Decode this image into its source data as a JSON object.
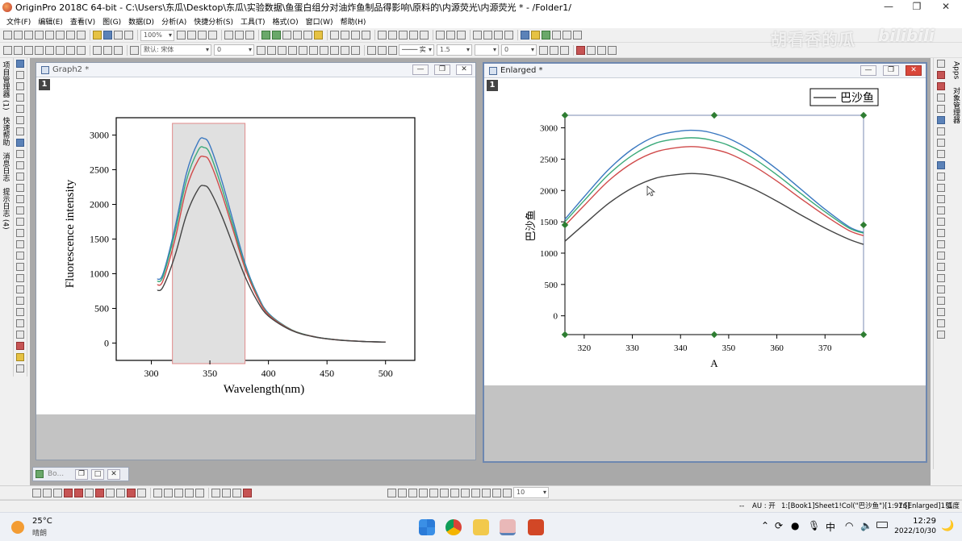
{
  "app": {
    "title": "OriginPro 2018C 64-bit - C:\\Users\\东瓜\\Desktop\\东瓜\\实验数据\\鱼蛋白组分对油炸鱼制品得影响\\原料的\\内源荧光\\内源荧光 * - /Folder1/",
    "window_controls": [
      "—",
      "❐",
      "✕"
    ]
  },
  "menu": [
    "文件(F)",
    "编辑(E)",
    "查看(V)",
    "图(G)",
    "数据(D)",
    "分析(A)",
    "快捷分析(S)",
    "工具(T)",
    "格式(O)",
    "窗口(W)",
    "帮助(H)"
  ],
  "toolbar": {
    "zoom": "100%",
    "font": "默认: 宋体",
    "font_size": "0",
    "line_width": "1.5",
    "line_extra": "0",
    "bottom_size": "10"
  },
  "watermark": "胡看香的瓜",
  "left_panel_labels": [
    "项目管理器 (1)",
    "快速帮助",
    "消息日志",
    "提示日志 (4)"
  ],
  "right_panel_labels": [
    "Apps",
    "对象管理器"
  ],
  "graph2": {
    "title": "Graph2 *",
    "layer": "1",
    "chart": {
      "xlabel": "Wavelength(nm)",
      "ylabel": "Fluorescence intensity",
      "xticks": [
        "300",
        "350",
        "400",
        "450",
        "500"
      ],
      "yticks": [
        "0",
        "500",
        "1000",
        "1500",
        "2000",
        "2500",
        "3000"
      ]
    }
  },
  "enlarged": {
    "title": "Enlarged *",
    "layer": "1",
    "legend": "巴沙鱼",
    "chart": {
      "xlabel": "A",
      "ylabel": "巴沙鱼",
      "xticks": [
        "320",
        "330",
        "340",
        "350",
        "360",
        "370"
      ],
      "yticks": [
        "0",
        "500",
        "1000",
        "1500",
        "2000",
        "2500",
        "3000"
      ]
    }
  },
  "minimized": {
    "label": "Bo..."
  },
  "status": {
    "left": "--",
    "au": "AU : 开",
    "cell": "1:[Book1]Sheet1!Col(\"巴沙鱼\")[1:976]",
    "layer": "1:[Enlarged]1!1",
    "unit": "弧度"
  },
  "taskbar": {
    "temp": "25°C",
    "weather": "晴朗",
    "ime": "中",
    "time": "12:29",
    "date": "2022/10/30"
  },
  "chart_data": [
    {
      "type": "line",
      "title": "",
      "xlabel": "Wavelength(nm)",
      "ylabel": "Fluorescence intensity",
      "xlim": [
        270,
        525
      ],
      "ylim": [
        -250,
        3250
      ],
      "grid": false,
      "highlight_region": [
        318,
        380
      ],
      "x": [
        305,
        310,
        320,
        330,
        340,
        345,
        350,
        360,
        370,
        380,
        390,
        400,
        420,
        440,
        460,
        480,
        500
      ],
      "series": [
        {
          "color": "#3a78c0",
          "values": [
            920,
            1000,
            1650,
            2450,
            2900,
            2950,
            2850,
            2350,
            1750,
            1150,
            720,
            430,
            190,
            90,
            45,
            25,
            15
          ]
        },
        {
          "color": "#3aaa7a",
          "values": [
            890,
            960,
            1580,
            2350,
            2780,
            2820,
            2730,
            2250,
            1680,
            1110,
            700,
            420,
            190,
            90,
            45,
            25,
            15
          ]
        },
        {
          "color": "#d04a4a",
          "values": [
            840,
            900,
            1480,
            2230,
            2640,
            2690,
            2610,
            2160,
            1620,
            1080,
            680,
            410,
            185,
            88,
            44,
            24,
            15
          ]
        },
        {
          "color": "#444444",
          "values": [
            760,
            810,
            1250,
            1850,
            2220,
            2270,
            2200,
            1840,
            1400,
            960,
            620,
            390,
            180,
            86,
            43,
            23,
            14
          ]
        }
      ]
    },
    {
      "type": "line",
      "title": "",
      "xlabel": "A",
      "ylabel": "巴沙鱼",
      "xlim": [
        316,
        378
      ],
      "ylim": [
        -300,
        3200
      ],
      "grid": false,
      "legend": [
        "巴沙鱼"
      ],
      "legend_position": "top-right",
      "x": [
        316,
        320,
        325,
        330,
        335,
        340,
        343,
        346,
        350,
        355,
        360,
        365,
        370,
        375,
        378
      ],
      "series": [
        {
          "color": "#3a78c0",
          "values": [
            1540,
            1900,
            2330,
            2660,
            2870,
            2950,
            2960,
            2930,
            2830,
            2620,
            2340,
            2020,
            1700,
            1420,
            1330
          ]
        },
        {
          "color": "#3aaa7a",
          "values": [
            1500,
            1840,
            2250,
            2560,
            2760,
            2830,
            2840,
            2810,
            2720,
            2520,
            2250,
            1950,
            1660,
            1400,
            1320
          ]
        },
        {
          "color": "#d04a4a",
          "values": [
            1440,
            1760,
            2150,
            2440,
            2620,
            2690,
            2700,
            2670,
            2590,
            2400,
            2150,
            1870,
            1600,
            1360,
            1280
          ]
        },
        {
          "color": "#444444",
          "values": [
            1190,
            1460,
            1790,
            2040,
            2200,
            2260,
            2270,
            2250,
            2180,
            2030,
            1830,
            1610,
            1400,
            1220,
            1140
          ]
        }
      ]
    }
  ]
}
